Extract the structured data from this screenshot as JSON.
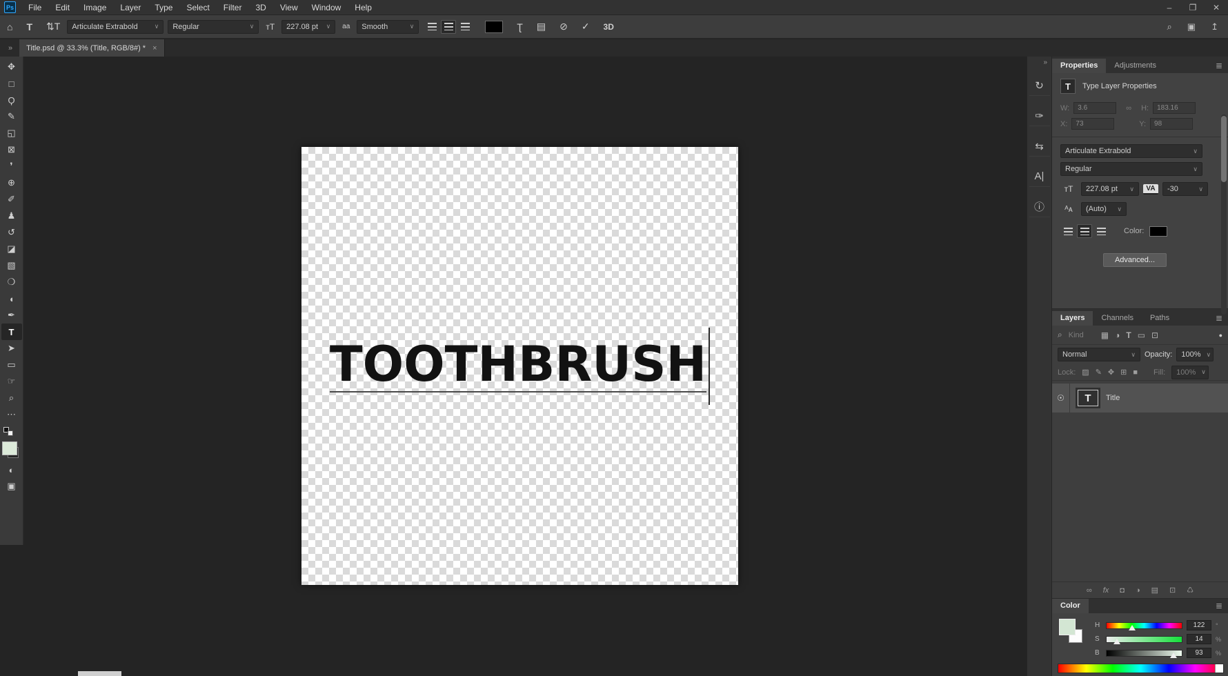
{
  "window": {
    "minimize_icon": "–",
    "restore_icon": "❐",
    "close_icon": "✕",
    "search_icon": "⌕",
    "workspace_icon": "▣",
    "share_icon": "↥"
  },
  "logo": "Ps",
  "menubar": {
    "items": [
      "File",
      "Edit",
      "Image",
      "Layer",
      "Type",
      "Select",
      "Filter",
      "3D",
      "View",
      "Window",
      "Help"
    ]
  },
  "options_bar": {
    "home_icon": "⌂",
    "type_tool_icon": "T",
    "orientation_icon": "⇅T",
    "font_family": "Articulate Extrabold",
    "font_style": "Regular",
    "size_icon": "тT",
    "font_size": "227.08 pt",
    "anti_alias_icon": "aa",
    "anti_alias": "Smooth",
    "warp_icon": "Ʈ",
    "panels_icon": "▤",
    "cancel_icon": "⊘",
    "commit_icon": "✓",
    "threed_label": "3D",
    "chevron": "∨",
    "text_color": "#000000"
  },
  "tab": {
    "overflow_icon": "»",
    "title": "Title.psd @ 33.3% (Title, RGB/8#) *",
    "close_icon": "×"
  },
  "toolbar": {
    "tools": [
      {
        "name": "move-tool",
        "glyph": "✥"
      },
      {
        "name": "marquee-tool",
        "glyph": "□"
      },
      {
        "name": "lasso-tool",
        "glyph": "Ϙ"
      },
      {
        "name": "quick-selection-tool",
        "glyph": "✎"
      },
      {
        "name": "crop-tool",
        "glyph": "◱"
      },
      {
        "name": "frame-tool",
        "glyph": "⊠"
      },
      {
        "name": "eyedropper-tool",
        "glyph": "❜"
      },
      {
        "name": "healing-brush-tool",
        "glyph": "⊕"
      },
      {
        "name": "brush-tool",
        "glyph": "✐"
      },
      {
        "name": "clone-stamp-tool",
        "glyph": "♟"
      },
      {
        "name": "history-brush-tool",
        "glyph": "↺"
      },
      {
        "name": "eraser-tool",
        "glyph": "◪"
      },
      {
        "name": "gradient-tool",
        "glyph": "▧"
      },
      {
        "name": "blur-tool",
        "glyph": "❍"
      },
      {
        "name": "dodge-tool",
        "glyph": "◖"
      },
      {
        "name": "pen-tool",
        "glyph": "✒"
      },
      {
        "name": "type-tool",
        "glyph": "T"
      },
      {
        "name": "path-selection-tool",
        "glyph": "➤"
      },
      {
        "name": "shape-tool",
        "glyph": "▭"
      },
      {
        "name": "hand-tool",
        "glyph": "☞"
      },
      {
        "name": "zoom-tool",
        "glyph": "⌕"
      },
      {
        "name": "edit-toolbar",
        "glyph": "⋯"
      }
    ],
    "quick_mask_icon": "◐",
    "screen_mode_icon": "▣",
    "foreground_color": "#dcead9"
  },
  "canvas": {
    "text": "TOOTHBRUSH"
  },
  "dock": {
    "collapse_icon": "»",
    "icons": [
      {
        "name": "history-panel-icon",
        "glyph": "↻"
      },
      {
        "name": "brush-settings-panel-icon",
        "glyph": "✑"
      },
      {
        "name": "clone-source-panel-icon",
        "glyph": "⇆"
      },
      {
        "name": "character-panel-icon",
        "glyph": "A|"
      },
      {
        "name": "info-panel-icon",
        "glyph": "ⓘ"
      }
    ]
  },
  "properties": {
    "tab_active": "Properties",
    "tab_inactive": "Adjustments",
    "menu_icon": "≣",
    "type_icon": "T",
    "header": "Type Layer Properties",
    "transform": {
      "w_label": "W:",
      "w_value": "3.6",
      "link_icon": "∞",
      "h_label": "H:",
      "h_value": "183.16",
      "x_label": "X:",
      "x_value": "73",
      "y_label": "Y:",
      "y_value": "98"
    },
    "font_family": "Articulate Extrabold",
    "font_style": "Regular",
    "size_icon": "тT",
    "font_size": "227.08 pt",
    "tracking_icon": "VA",
    "tracking": "-30",
    "leading_icon": "ᴬᴀ",
    "leading": "(Auto)",
    "color_label": "Color:",
    "color_value": "#000000",
    "advanced_label": "Advanced...",
    "chevron": "∨"
  },
  "layers": {
    "tab_layers": "Layers",
    "tab_channels": "Channels",
    "tab_paths": "Paths",
    "menu_icon": "≣",
    "filter": {
      "search_icon": "⌕",
      "kind_label": "Kind",
      "pixel_icon": "▦",
      "adjust_icon": "◑",
      "type_icon": "T",
      "shape_icon": "▭",
      "smart_icon": "⊡",
      "toggle_dot": "●"
    },
    "blend_mode": "Normal",
    "opacity_label": "Opacity:",
    "opacity": "100%",
    "lock_label": "Lock:",
    "lock_icons": [
      "▨",
      "✎",
      "✥",
      "⊞",
      "■"
    ],
    "fill_label": "Fill:",
    "fill": "100%",
    "layer": {
      "eye_icon": "☉",
      "thumb_letter": "T",
      "name": "Title"
    },
    "bottom_icons": [
      {
        "name": "link-layers-icon",
        "glyph": "∞"
      },
      {
        "name": "layer-effects-icon",
        "glyph": "fx"
      },
      {
        "name": "layer-mask-icon",
        "glyph": "◘"
      },
      {
        "name": "adjustment-layer-icon",
        "glyph": "◑"
      },
      {
        "name": "layer-group-icon",
        "glyph": "▤"
      },
      {
        "name": "new-layer-icon",
        "glyph": "⊡"
      },
      {
        "name": "delete-layer-icon",
        "glyph": "♺"
      }
    ],
    "chevron": "∨"
  },
  "color_panel": {
    "tab": "Color",
    "menu_icon": "≣",
    "foreground": "#d3e6d3",
    "background": "#ffffff",
    "sliders": [
      {
        "label": "H",
        "value": "122",
        "unit": "°"
      },
      {
        "label": "S",
        "value": "14",
        "unit": "%"
      },
      {
        "label": "B",
        "value": "93",
        "unit": "%"
      }
    ]
  }
}
